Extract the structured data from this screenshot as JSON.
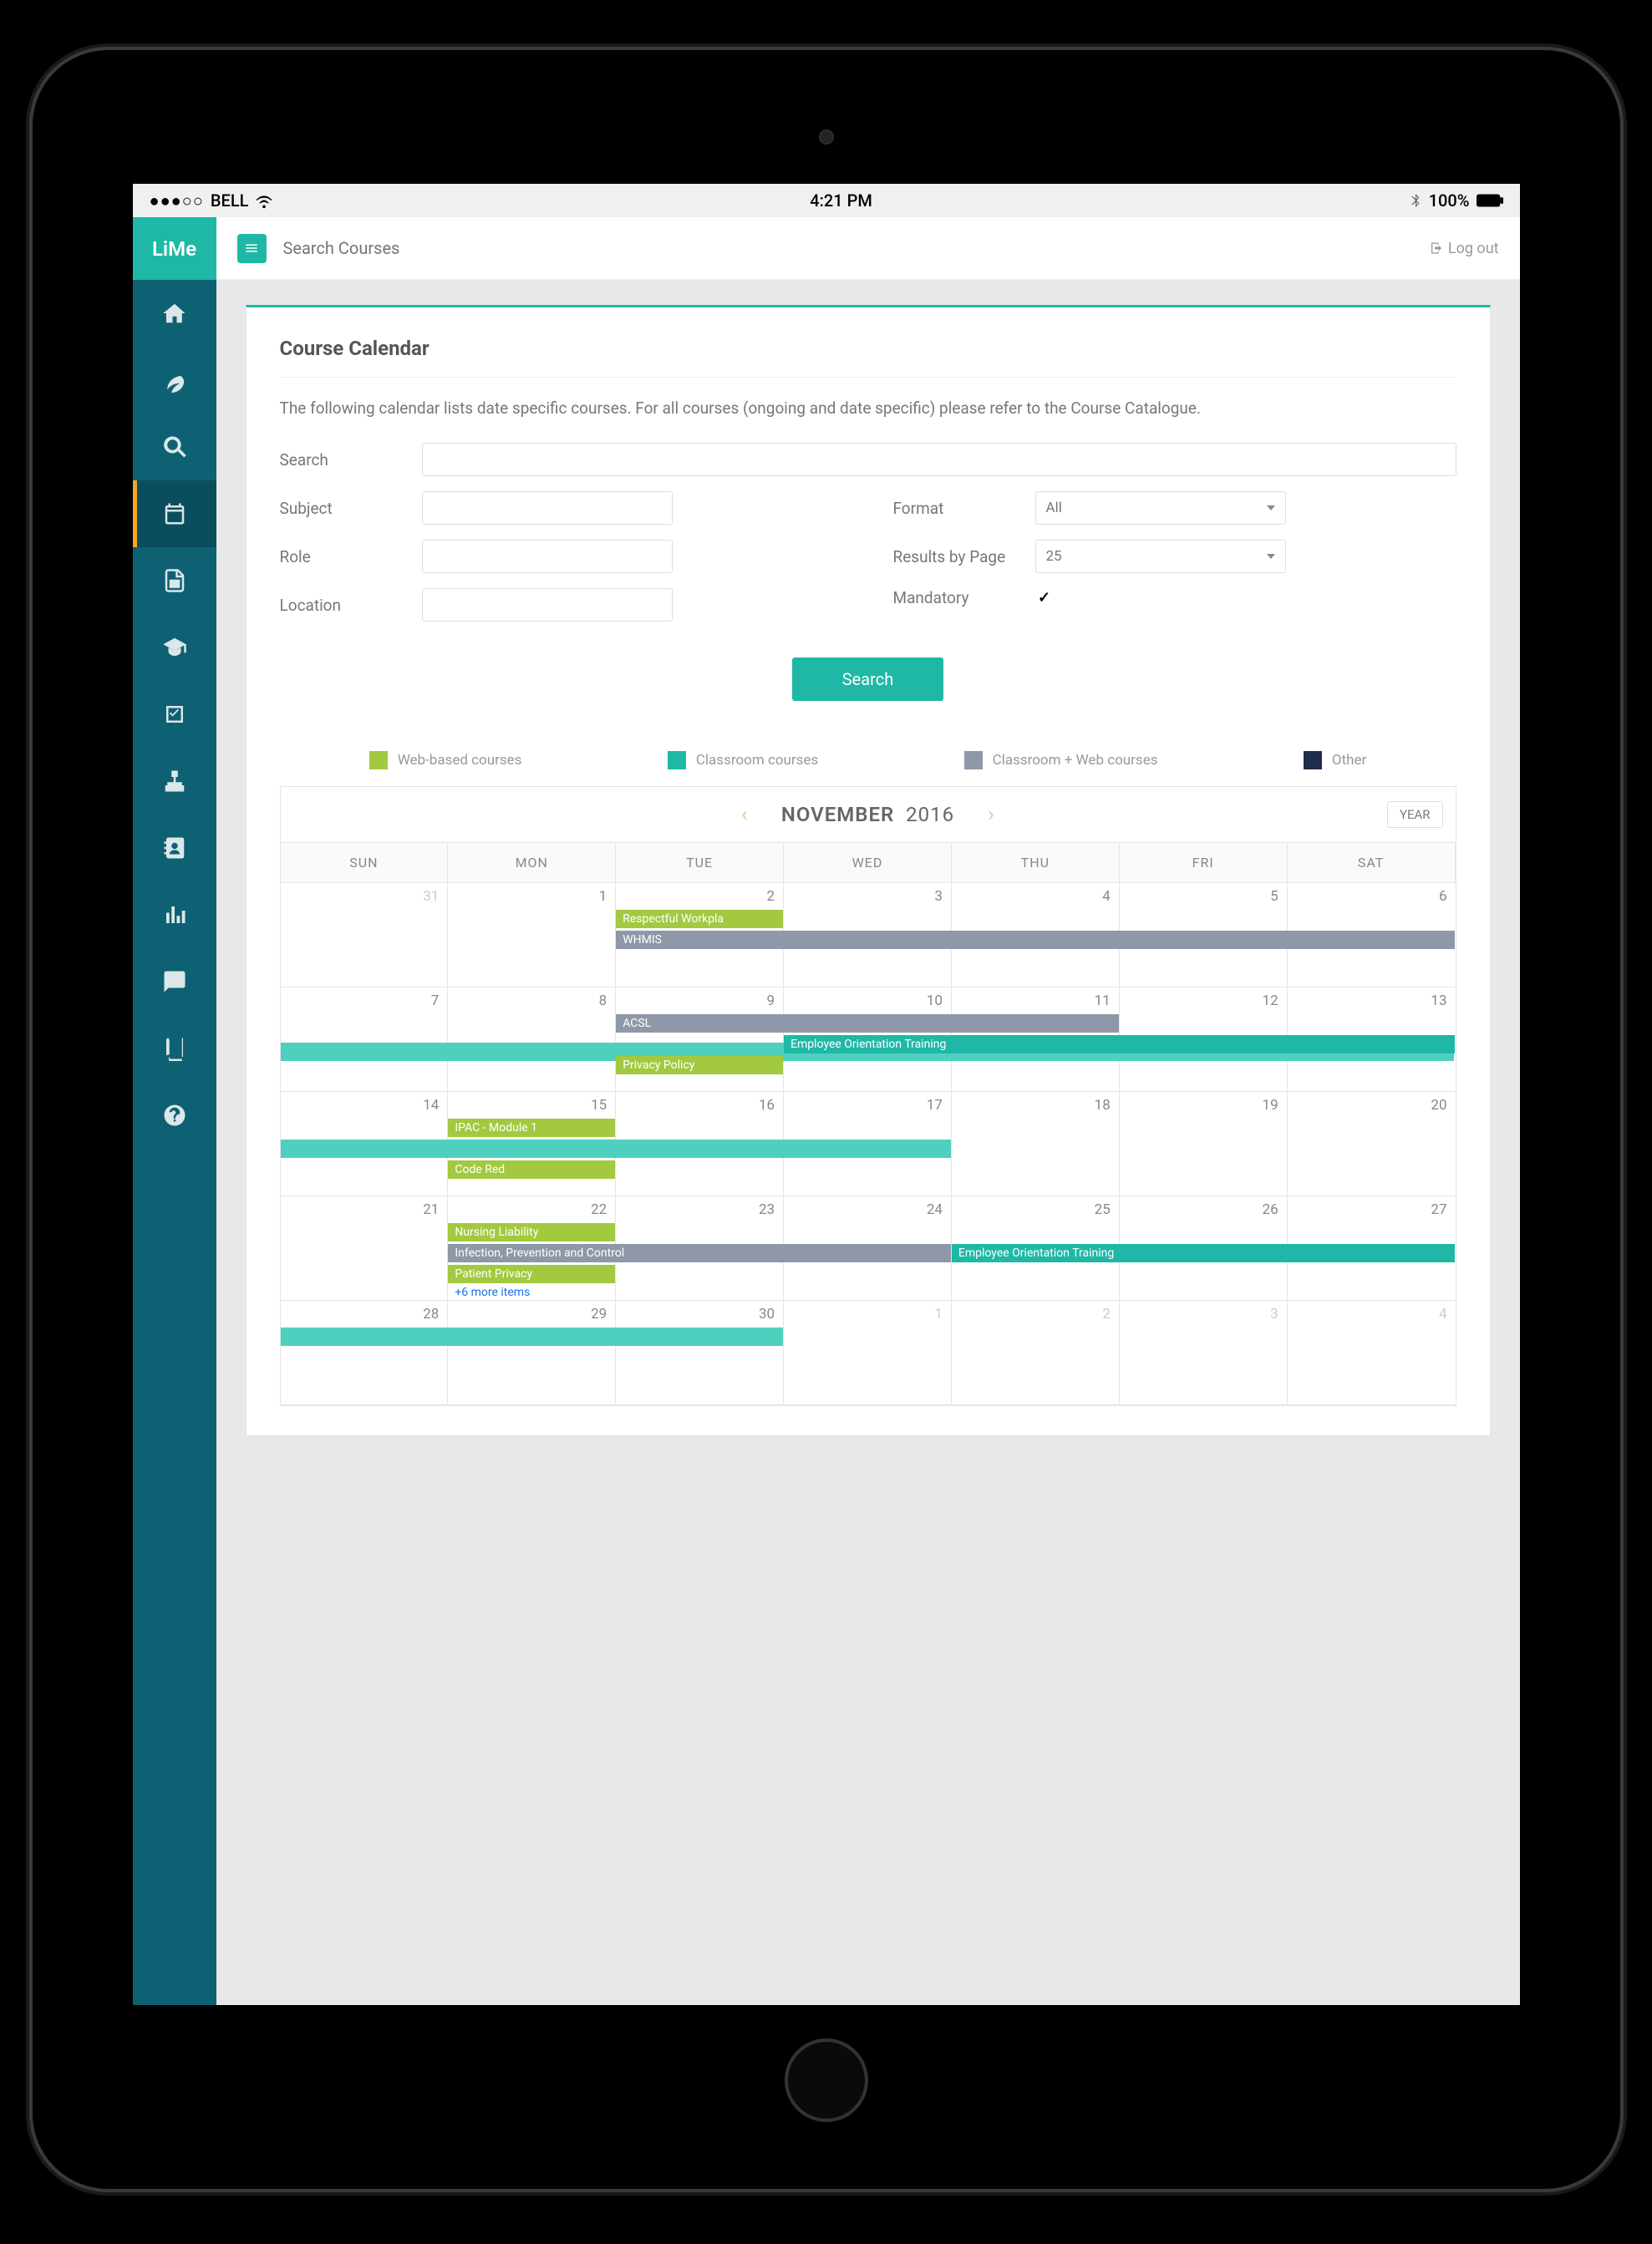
{
  "status": {
    "dots": "●●●○○",
    "carrier": "BELL",
    "time": "4:21 PM",
    "battery": "100%"
  },
  "brand": "LiMe",
  "topbar": {
    "search_placeholder": "Search Courses",
    "logout": "Log out"
  },
  "page": {
    "title": "Course Calendar",
    "desc": "The following calendar lists date specific courses.  For all courses (ongoing and date specific) please refer to the Course Catalogue.",
    "labels": {
      "search": "Search",
      "subject": "Subject",
      "role": "Role",
      "location": "Location",
      "format": "Format",
      "results": "Results by Page",
      "mandatory": "Mandatory"
    },
    "format_value": "All",
    "results_value": "25",
    "search_btn": "Search"
  },
  "legend": [
    {
      "label": "Web-based courses",
      "color": "#a2c940"
    },
    {
      "label": "Classroom courses",
      "color": "#1fb8a6"
    },
    {
      "label": "Classroom + Web courses",
      "color": "#8e98a8"
    },
    {
      "label": "Other",
      "color": "#1f2c4a"
    }
  ],
  "calendar": {
    "month": "NOVEMBER",
    "year": "2016",
    "year_btn": "YEAR",
    "day_headers": [
      "SUN",
      "MON",
      "TUE",
      "WED",
      "THU",
      "FRI",
      "SAT"
    ],
    "weeks": [
      [
        {
          "d": "31",
          "muted": true
        },
        {
          "d": "1"
        },
        {
          "d": "2",
          "events": [
            {
              "t": "Respectful Workpla",
              "c": "c-green",
              "span": 1
            },
            {
              "t": "WHMIS",
              "c": "c-gray",
              "span": 5
            }
          ]
        },
        {
          "d": "3"
        },
        {
          "d": "4"
        },
        {
          "d": "5"
        },
        {
          "d": "6"
        }
      ],
      [
        {
          "d": "7",
          "events": [
            {
              "t": "",
              "c": "c-teal-lt",
              "span": 7,
              "offset": 34
            }
          ]
        },
        {
          "d": "8"
        },
        {
          "d": "9",
          "events": [
            {
              "t": "ACSL",
              "c": "c-gray",
              "span": 3
            },
            {
              "t": "",
              "skip": true
            },
            {
              "t": "Privacy Policy",
              "c": "c-green",
              "span": 1
            }
          ]
        },
        {
          "d": "10",
          "events": [
            {
              "t": "",
              "skip": true
            },
            {
              "t": "Employee Orientation Training",
              "c": "c-teal",
              "span": 4
            }
          ]
        },
        {
          "d": "11"
        },
        {
          "d": "12"
        },
        {
          "d": "13"
        }
      ],
      [
        {
          "d": "14",
          "events": [
            {
              "t": "",
              "skip": true
            },
            {
              "t": "",
              "c": "c-teal-lt",
              "span": 4
            }
          ]
        },
        {
          "d": "15",
          "events": [
            {
              "t": "IPAC - Module 1",
              "c": "c-green",
              "span": 1
            },
            {
              "t": "",
              "skip": true
            },
            {
              "t": "Code Red",
              "c": "c-green",
              "span": 1
            }
          ]
        },
        {
          "d": "16"
        },
        {
          "d": "17"
        },
        {
          "d": "18"
        },
        {
          "d": "19"
        },
        {
          "d": "20"
        }
      ],
      [
        {
          "d": "21"
        },
        {
          "d": "22",
          "events": [
            {
              "t": "Nursing Liability",
              "c": "c-green",
              "span": 1
            },
            {
              "t": "Infection, Prevention and Control",
              "c": "c-gray",
              "span": 3
            },
            {
              "t": "Patient Privacy",
              "c": "c-green",
              "span": 1
            }
          ],
          "more": "+6 more items"
        },
        {
          "d": "23"
        },
        {
          "d": "24"
        },
        {
          "d": "25",
          "events": [
            {
              "t": "",
              "skip": true
            },
            {
              "t": "Employee Orientation Training",
              "c": "c-teal",
              "span": 3
            }
          ]
        },
        {
          "d": "26"
        },
        {
          "d": "27"
        }
      ],
      [
        {
          "d": "28",
          "events": [
            {
              "t": "",
              "c": "c-teal-lt",
              "span": 3
            }
          ]
        },
        {
          "d": "29"
        },
        {
          "d": "30"
        },
        {
          "d": "1",
          "muted": true
        },
        {
          "d": "2",
          "muted": true
        },
        {
          "d": "3",
          "muted": true
        },
        {
          "d": "4",
          "muted": true
        }
      ]
    ]
  }
}
